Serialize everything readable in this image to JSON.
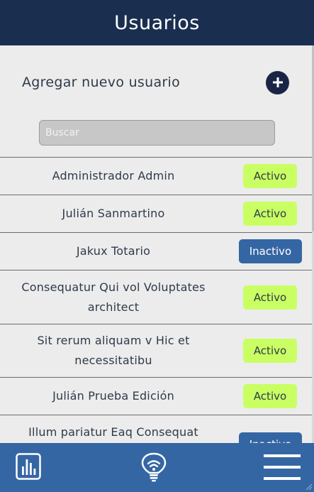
{
  "header": {
    "title": "Usuarios"
  },
  "add_user": {
    "label": "Agregar nuevo usuario"
  },
  "search": {
    "placeholder": "Buscar",
    "value": ""
  },
  "users": [
    {
      "name": "Administrador Admin",
      "status": "Activo"
    },
    {
      "name": "Julián Sanmartino",
      "status": "Activo"
    },
    {
      "name": "Jakux Totario",
      "status": "Inactivo"
    },
    {
      "name": "Consequatur Qui vol Voluptates architect",
      "status": "Activo"
    },
    {
      "name": "Sit rerum aliquam v Hic et necessitatibu",
      "status": "Activo"
    },
    {
      "name": "Julián Prueba Edición",
      "status": "Activo"
    },
    {
      "name": "Illum pariatur Eaq Consequat",
      "status": "Inactivo"
    }
  ],
  "footer": {
    "icons": [
      "bar-chart-icon",
      "lightbulb-icon",
      "hamburger-menu-icon"
    ]
  },
  "colors": {
    "header_bg": "#1a2e4f",
    "footer_bg": "#3566a4",
    "active_badge": "#c9ff63",
    "inactive_badge": "#3566a4",
    "add_button": "#1a2546"
  }
}
